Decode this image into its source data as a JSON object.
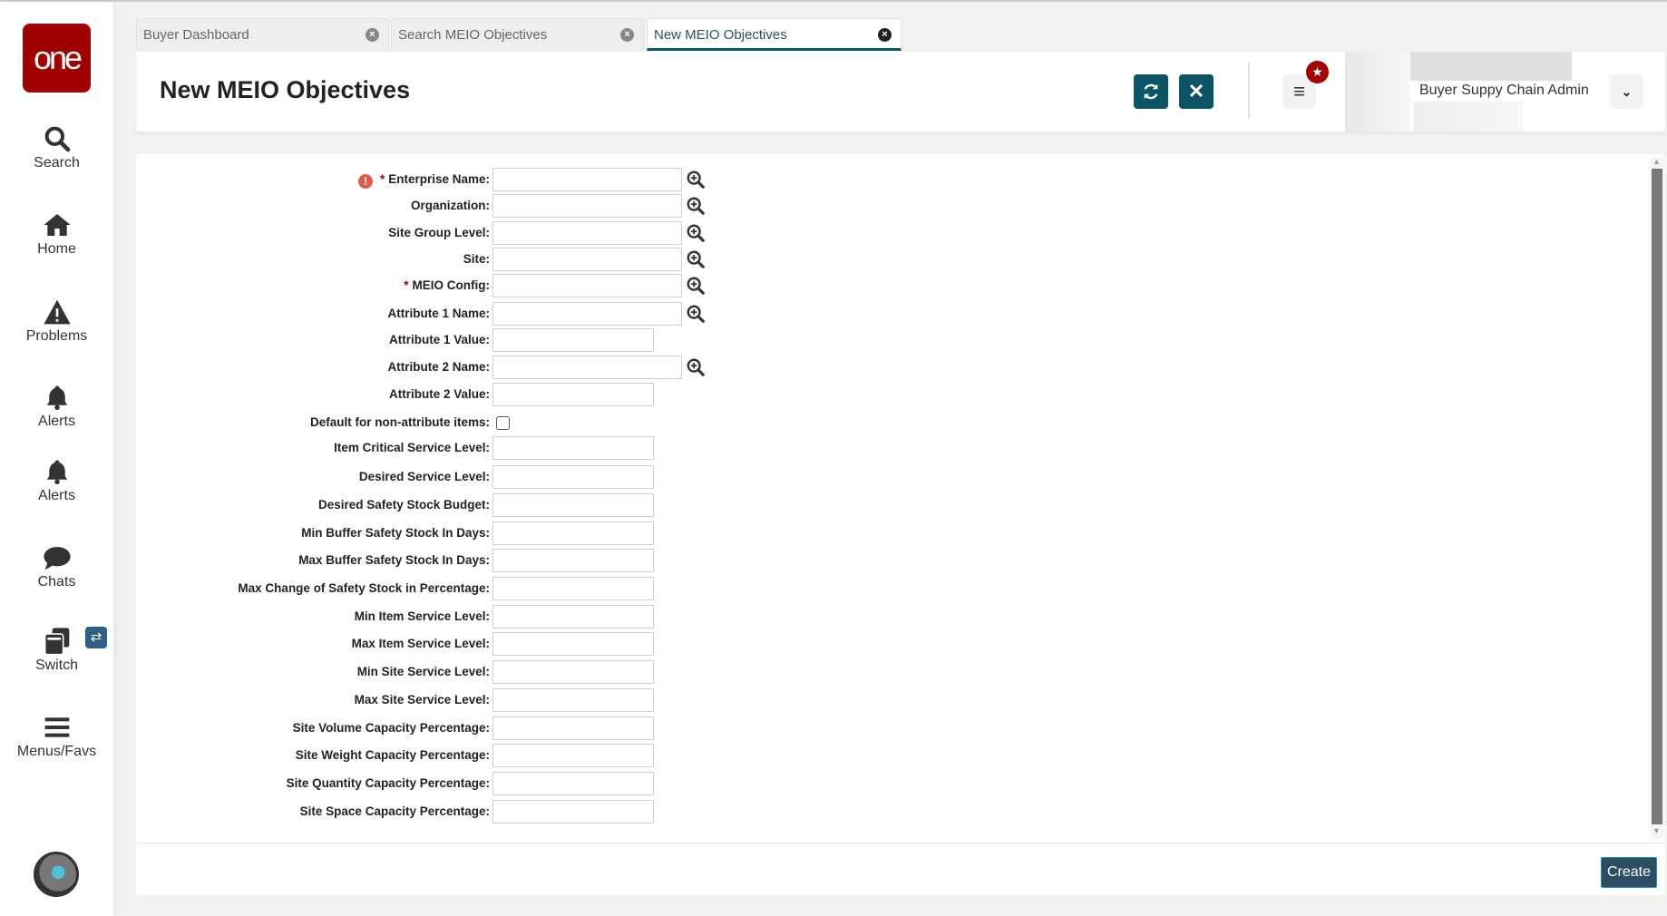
{
  "sidebar": {
    "logo": "one",
    "items": [
      {
        "label": "Search",
        "icon": "search-icon"
      },
      {
        "label": "Home",
        "icon": "home-icon"
      },
      {
        "label": "Problems",
        "icon": "warning-icon"
      },
      {
        "label": "Alerts",
        "icon": "bell-icon"
      },
      {
        "label": "Alerts",
        "icon": "bell-icon"
      },
      {
        "label": "Chats",
        "icon": "chat-icon"
      },
      {
        "label": "Switch",
        "icon": "switch-icon"
      },
      {
        "label": "Menus/Favs",
        "icon": "menu-icon"
      }
    ]
  },
  "tabs": [
    {
      "label": "Buyer Dashboard"
    },
    {
      "label": "Search MEIO Objectives"
    },
    {
      "label": "New MEIO Objectives",
      "active": true
    }
  ],
  "header": {
    "title": "New MEIO Objectives",
    "user_role": "Buyer Suppy Chain Admin"
  },
  "form": {
    "fields": [
      {
        "label": "Enterprise Name:",
        "required": true,
        "error": true,
        "type": "lookup",
        "value": ""
      },
      {
        "label": "Organization:",
        "type": "lookup",
        "value": ""
      },
      {
        "label": "Site Group Level:",
        "type": "lookup",
        "value": ""
      },
      {
        "label": "Site:",
        "type": "lookup",
        "value": ""
      },
      {
        "label": "MEIO Config:",
        "required": true,
        "type": "lookup",
        "value": ""
      },
      {
        "label": "Attribute 1 Name:",
        "type": "lookup",
        "value": ""
      },
      {
        "label": "Attribute 1 Value:",
        "type": "text",
        "value": ""
      },
      {
        "label": "Attribute 2 Name:",
        "type": "lookup",
        "value": ""
      },
      {
        "label": "Attribute 2 Value:",
        "type": "text",
        "value": ""
      },
      {
        "label": "Default for non-attribute items:",
        "type": "checkbox",
        "checked": false
      },
      {
        "label": "Item Critical Service Level:",
        "type": "text",
        "value": ""
      },
      {
        "label": "Desired Service Level:",
        "type": "text",
        "value": ""
      },
      {
        "label": "Desired Safety Stock Budget:",
        "type": "text",
        "value": ""
      },
      {
        "label": "Min Buffer Safety Stock In Days:",
        "type": "text",
        "value": ""
      },
      {
        "label": "Max Buffer Safety Stock In Days:",
        "type": "text",
        "value": ""
      },
      {
        "label": "Max Change of Safety Stock in Percentage:",
        "type": "text",
        "value": ""
      },
      {
        "label": "Min Item Service Level:",
        "type": "text",
        "value": ""
      },
      {
        "label": "Max Item Service Level:",
        "type": "text",
        "value": ""
      },
      {
        "label": "Min Site Service Level:",
        "type": "text",
        "value": ""
      },
      {
        "label": "Max Site Service Level:",
        "type": "text",
        "value": ""
      },
      {
        "label": "Site Volume Capacity Percentage:",
        "type": "text",
        "value": ""
      },
      {
        "label": "Site Weight Capacity Percentage:",
        "type": "text",
        "value": ""
      },
      {
        "label": "Site Quantity Capacity Percentage:",
        "type": "text",
        "value": ""
      },
      {
        "label": "Site Space Capacity Percentage:",
        "type": "text",
        "value": ""
      }
    ]
  },
  "footer": {
    "create_label": "Create"
  },
  "colors": {
    "brand": "#a00000",
    "accent": "#0b5566",
    "create": "#2c4d66"
  }
}
